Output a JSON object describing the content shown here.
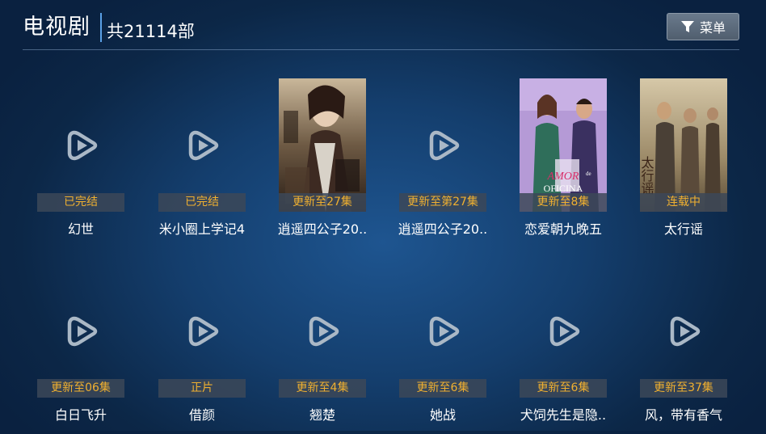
{
  "header": {
    "title": "电视剧",
    "count": "共21114部",
    "menu_label": "菜单"
  },
  "colors": {
    "badge_text": "#f0b030",
    "accent_divider": "#5aa0e6",
    "background": "#143e6d"
  },
  "rows": [
    [
      {
        "title": "幻世",
        "badge": "已完结",
        "poster": "placeholder"
      },
      {
        "title": "米小圈上学记4",
        "badge": "已完结",
        "poster": "placeholder"
      },
      {
        "title": "逍遥四公子20..",
        "badge": "更新至27集",
        "poster": "image"
      },
      {
        "title": "逍遥四公子20..",
        "badge": "更新至第27集",
        "poster": "placeholder"
      },
      {
        "title": "恋爱朝九晚五",
        "badge": "更新至8集",
        "poster": "image"
      },
      {
        "title": "太行谣",
        "badge": "连载中",
        "poster": "image"
      }
    ],
    [
      {
        "title": "白日飞升",
        "badge": "更新至06集",
        "poster": "placeholder"
      },
      {
        "title": "借颜",
        "badge": "正片",
        "poster": "placeholder"
      },
      {
        "title": "翘楚",
        "badge": "更新至4集",
        "poster": "placeholder"
      },
      {
        "title": "她战",
        "badge": "更新至6集",
        "poster": "placeholder"
      },
      {
        "title": "犬饲先生是隐..",
        "badge": "更新至6集",
        "poster": "placeholder"
      },
      {
        "title": "风，带有香气",
        "badge": "更新至37集",
        "poster": "placeholder"
      }
    ]
  ],
  "poster_text": {
    "amor": "AMOR",
    "oficina": "OFICINA",
    "de": "de",
    "taihang": "太行谣"
  }
}
